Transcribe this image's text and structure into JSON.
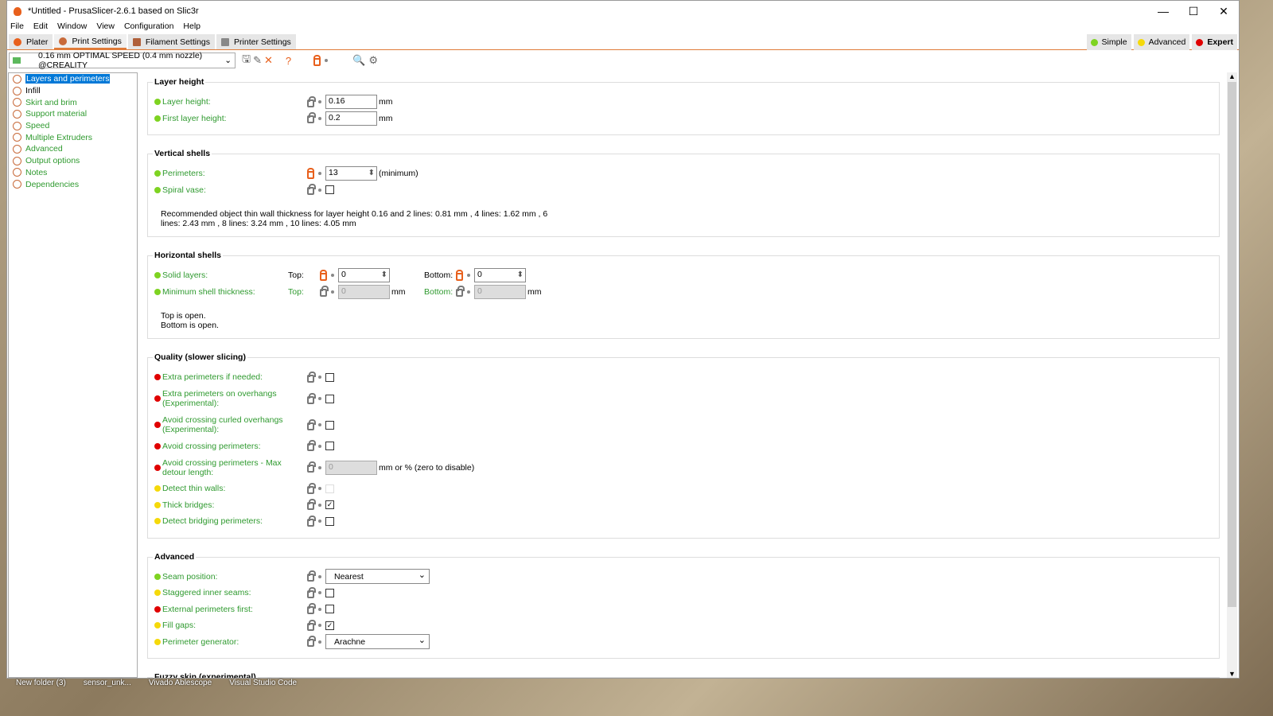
{
  "window": {
    "title": "*Untitled - PrusaSlicer-2.6.1 based on Slic3r"
  },
  "menu": [
    "File",
    "Edit",
    "Window",
    "View",
    "Configuration",
    "Help"
  ],
  "tabs": [
    {
      "label": "Plater",
      "color": "#e8601c"
    },
    {
      "label": "Print Settings",
      "color": "#c86a3a"
    },
    {
      "label": "Filament Settings",
      "color": "#b0603a"
    },
    {
      "label": "Printer Settings",
      "color": "#888"
    }
  ],
  "modes": [
    {
      "label": "Simple",
      "color": "#7ed321"
    },
    {
      "label": "Advanced",
      "color": "#f5d90a"
    },
    {
      "label": "Expert",
      "color": "#e00000"
    }
  ],
  "preset": {
    "value": "0.16 mm OPTIMAL SPEED (0.4 mm nozzle) @CREALITY"
  },
  "tree": [
    "Layers and perimeters",
    "Infill",
    "Skirt and brim",
    "Support material",
    "Speed",
    "Multiple Extruders",
    "Advanced",
    "Output options",
    "Notes",
    "Dependencies"
  ],
  "sections": [
    {
      "title": "Layer height",
      "rows": [
        {
          "label": "Layer height:",
          "level": "simple",
          "type": "text",
          "value": "0.16",
          "unit": "mm"
        },
        {
          "label": "First layer height:",
          "level": "simple",
          "type": "text",
          "value": "0.2",
          "unit": "mm"
        }
      ]
    },
    {
      "title": "Vertical shells",
      "rows": [
        {
          "label": "Perimeters:",
          "level": "simple",
          "type": "spin",
          "value": "13",
          "unit": "(minimum)",
          "unlocked": true
        },
        {
          "label": "Spiral vase:",
          "level": "simple",
          "type": "check",
          "value": false
        }
      ],
      "note": "Recommended object thin wall thickness for layer height 0.16 and 2 lines: 0.81 mm , 4 lines: 1.62 mm , 6 lines: 2.43 mm , 8 lines: 3.24 mm , 10 lines: 4.05 mm"
    },
    {
      "title": "Horizontal shells",
      "rows": [
        {
          "label": "Solid layers:",
          "level": "simple",
          "type": "pair",
          "sub": [
            {
              "label": "Top:",
              "value": "0",
              "unlocked": true,
              "spin": true
            },
            {
              "label": "Bottom:",
              "value": "0",
              "unlocked": true,
              "spin": true
            }
          ]
        },
        {
          "label": "Minimum shell thickness:",
          "level": "simple",
          "type": "pair",
          "sub": [
            {
              "label": "Top:",
              "value": "0",
              "disabled": true,
              "unit": "mm",
              "green": true
            },
            {
              "label": "Bottom:",
              "value": "0",
              "disabled": true,
              "unit": "mm",
              "green": true
            }
          ]
        }
      ],
      "note": "Top is open.\nBottom is open."
    },
    {
      "title": "Quality (slower slicing)",
      "rows": [
        {
          "label": "Extra perimeters if needed:",
          "level": "expert",
          "type": "check",
          "value": false
        },
        {
          "label": "Extra perimeters on overhangs (Experimental):",
          "level": "expert",
          "type": "check",
          "value": false,
          "tall": true
        },
        {
          "label": "Avoid crossing curled overhangs (Experimental):",
          "level": "expert",
          "type": "check",
          "value": false,
          "tall": true
        },
        {
          "label": "Avoid crossing perimeters:",
          "level": "expert",
          "type": "check",
          "value": false
        },
        {
          "label": "Avoid crossing perimeters - Max detour length:",
          "level": "expert",
          "type": "text",
          "value": "0",
          "disabled": true,
          "unit": "mm or % (zero to disable)",
          "tall": true
        },
        {
          "label": "Detect thin walls:",
          "level": "advanced",
          "type": "check",
          "value": false,
          "disabled": true
        },
        {
          "label": "Thick bridges:",
          "level": "advanced",
          "type": "check",
          "value": true
        },
        {
          "label": "Detect bridging perimeters:",
          "level": "advanced",
          "type": "check",
          "value": false
        }
      ]
    },
    {
      "title": "Advanced",
      "rows": [
        {
          "label": "Seam position:",
          "level": "simple",
          "type": "combo",
          "value": "Nearest"
        },
        {
          "label": "Staggered inner seams:",
          "level": "advanced",
          "type": "check",
          "value": false
        },
        {
          "label": "External perimeters first:",
          "level": "expert",
          "type": "check",
          "value": false
        },
        {
          "label": "Fill gaps:",
          "level": "advanced",
          "type": "check",
          "value": true
        },
        {
          "label": "Perimeter generator:",
          "level": "advanced",
          "type": "combo",
          "value": "Arachne"
        }
      ]
    },
    {
      "title": "Fuzzy skin (experimental)",
      "rows": []
    }
  ],
  "desktop": [
    "New folder (3)",
    "sensor_unk...",
    "Vivado Ablescope",
    "Visual Studio Code"
  ]
}
